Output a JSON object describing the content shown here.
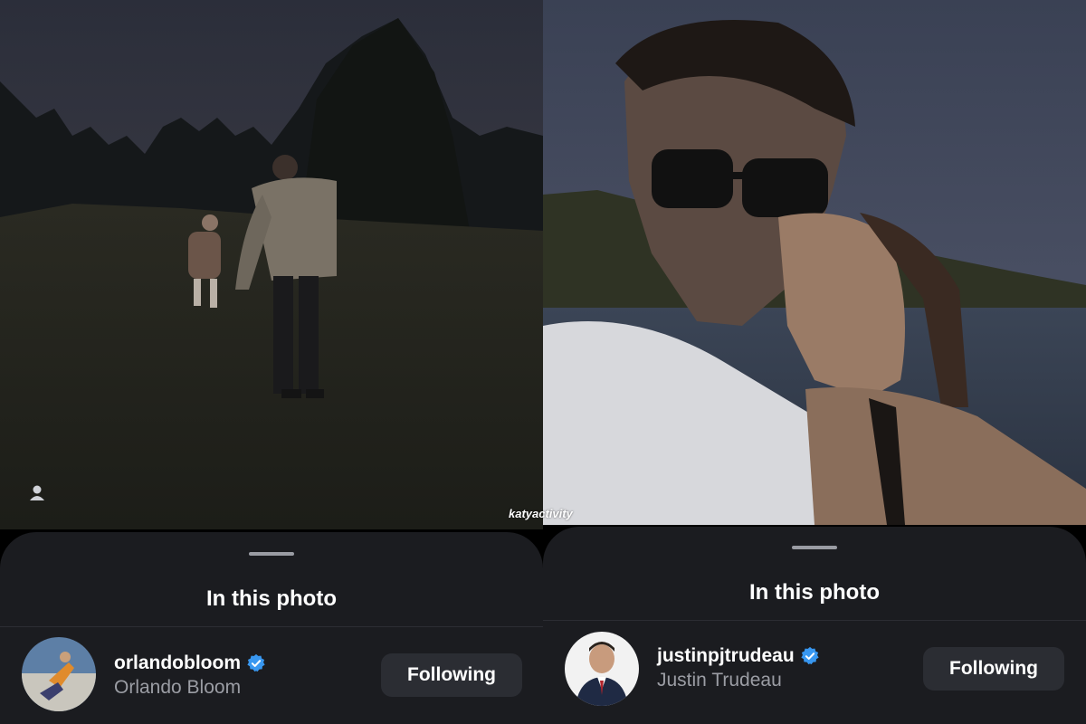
{
  "watermark": "katyactivity",
  "colors": {
    "sheet_background": "#1b1c20",
    "button_background": "#2b2d33",
    "verified_blue": "#3897f0",
    "secondary_text": "#9b9da4"
  },
  "panels": [
    {
      "sheet": {
        "title": "In this photo",
        "user": {
          "username": "orlandobloom",
          "full_name": "Orlando Bloom",
          "verified": true,
          "follow_label": "Following"
        }
      },
      "icons": [
        "person-tag-icon",
        "verified-badge-icon"
      ]
    },
    {
      "sheet": {
        "title": "In this photo",
        "user": {
          "username": "justinpjtrudeau",
          "full_name": "Justin Trudeau",
          "verified": true,
          "follow_label": "Following"
        }
      },
      "icons": [
        "verified-badge-icon"
      ]
    }
  ]
}
